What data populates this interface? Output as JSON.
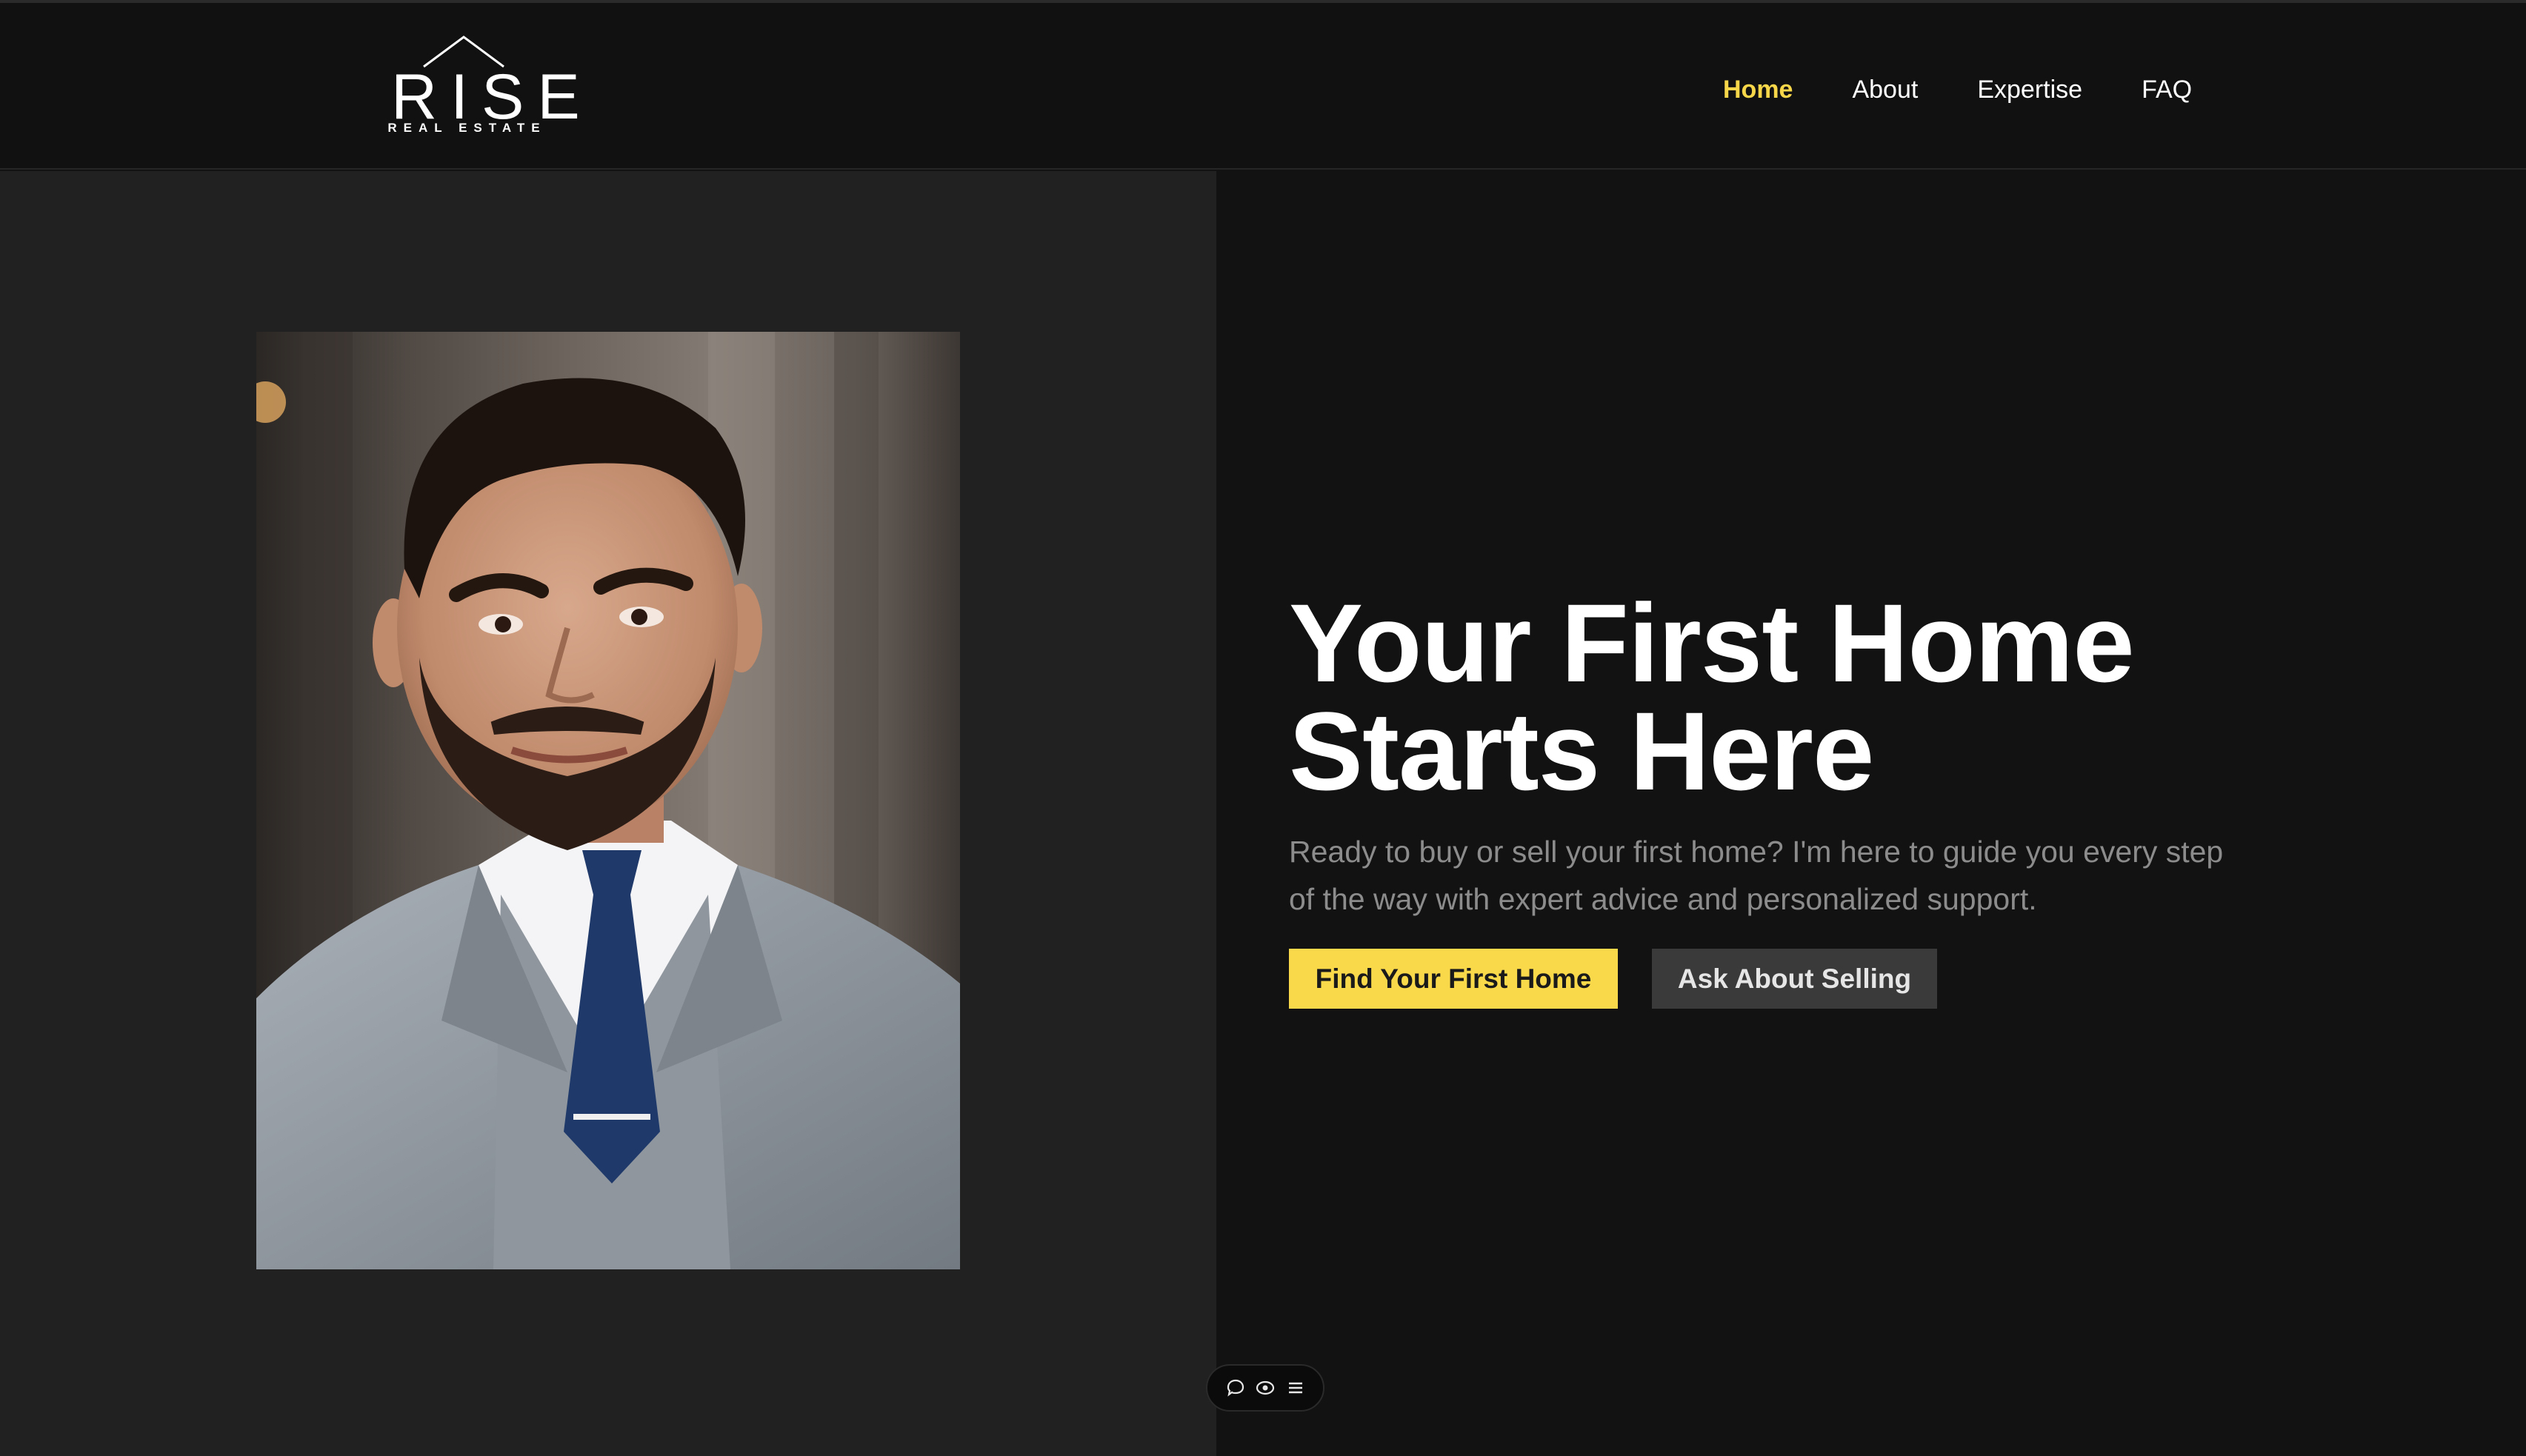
{
  "header": {
    "logo": {
      "wordmark": "RISE",
      "tagline": "REAL ESTATE",
      "icon": "house-roof-icon"
    },
    "nav": [
      {
        "label": "Home",
        "active": true
      },
      {
        "label": "About",
        "active": false
      },
      {
        "label": "Expertise",
        "active": false
      },
      {
        "label": "FAQ",
        "active": false
      }
    ]
  },
  "hero": {
    "title_line1": "Your First Home",
    "title_line2": "Starts Here",
    "subtitle": "Ready to buy or sell your first home? I'm here to guide you every step of the way with expert advice and personalized support.",
    "primary_button": "Find Your First Home",
    "secondary_button": "Ask About Selling",
    "portrait_icon": "agent-portrait-image"
  },
  "floating_toolbar": {
    "icons": [
      "comment-icon",
      "eye-icon",
      "menu-icon"
    ]
  },
  "colors": {
    "accent": "#f9d84a",
    "nav_active": "#f7d64a",
    "header_bg": "#111111",
    "left_panel_bg": "#212121",
    "right_panel_bg": "#121212",
    "secondary_button_bg": "#3a3a3a",
    "subtitle_text": "#8c8c8c"
  }
}
